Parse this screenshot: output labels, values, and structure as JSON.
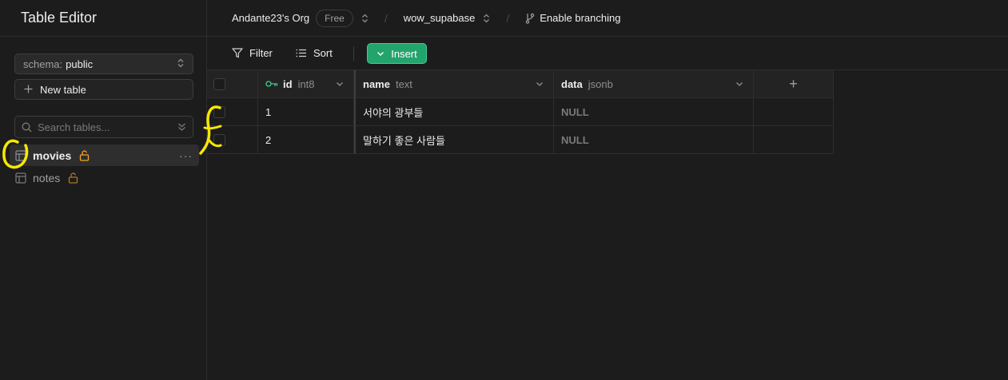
{
  "sidebar": {
    "title": "Table Editor",
    "schema_label": "schema:",
    "schema_value": "public",
    "new_table_label": "New table",
    "search_placeholder": "Search tables...",
    "tables": [
      {
        "name": "movies",
        "active": true
      },
      {
        "name": "notes",
        "active": false
      }
    ],
    "more_label": "···"
  },
  "topbar": {
    "org": "Andante23's Org",
    "plan_badge": "Free",
    "separator": "/",
    "project": "wow_supabase",
    "branching": "Enable branching"
  },
  "toolbar": {
    "filter_label": "Filter",
    "sort_label": "Sort",
    "insert_label": "Insert"
  },
  "grid": {
    "columns": [
      {
        "name": "id",
        "type": "int8"
      },
      {
        "name": "name",
        "type": "text"
      },
      {
        "name": "data",
        "type": "jsonb"
      }
    ],
    "add_column_label": "+",
    "rows": [
      {
        "id": "1",
        "name": "서야의 광부들",
        "data": "NULL"
      },
      {
        "id": "2",
        "name": "말하기 좋은 사람들",
        "data": "NULL"
      }
    ]
  },
  "colors": {
    "accent": "#3ecf8e",
    "insert_bg": "#24a46d",
    "lock": "#f5a623",
    "annotation": "#f5e800"
  }
}
